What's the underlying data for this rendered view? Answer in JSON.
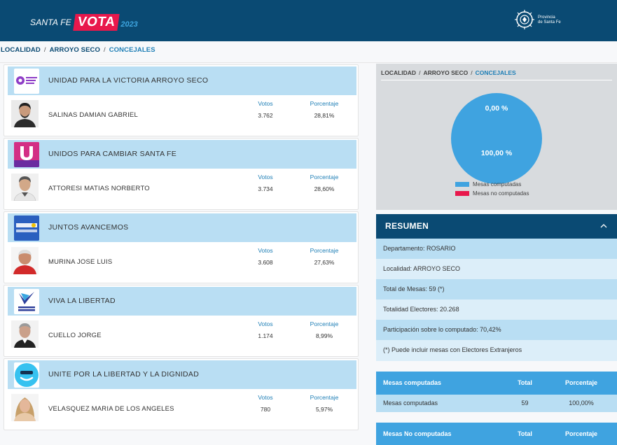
{
  "header": {
    "brand_santafe": "SANTA FE",
    "brand_vota": "VOTA",
    "brand_year": "2023",
    "province_line1": "Provincia",
    "province_line2": "de Santa Fe"
  },
  "breadcrumb": {
    "items": [
      "LOCALIDAD",
      "ARROYO SECO",
      "CONCEJALES"
    ],
    "separator": "/"
  },
  "results": {
    "votes_header": "Votos",
    "percent_header": "Porcentaje",
    "parties": [
      {
        "party": "UNIDAD PARA LA VICTORIA ARROYO SECO",
        "logo_text": "Unidad para la Victoria",
        "candidate": "SALINAS DAMIAN GABRIEL",
        "votes": "3.762",
        "percent": "28,81%"
      },
      {
        "party": "UNIDOS PARA CAMBIAR SANTA FE",
        "logo_text": "U",
        "candidate": "ATTORESI MATIAS NORBERTO",
        "votes": "3.734",
        "percent": "28,60%"
      },
      {
        "party": "JUNTOS AVANCEMOS",
        "logo_text": "JUNTOS AVANCEMOS",
        "candidate": "MURINA JOSE LUIS",
        "votes": "3.608",
        "percent": "27,63%"
      },
      {
        "party": "VIVA LA LIBERTAD",
        "logo_text": "VIVA LA LIBERTAD",
        "candidate": "CUELLO JORGE",
        "votes": "1.174",
        "percent": "8,99%"
      },
      {
        "party": "UNITE POR LA LIBERTAD Y LA DIGNIDAD",
        "logo_text": "Unite",
        "candidate": "VELASQUEZ MARIA DE LOS ANGELES",
        "votes": "780",
        "percent": "5,97%"
      }
    ]
  },
  "chart_panel": {
    "breadcrumb": [
      "LOCALIDAD",
      "ARROYO SECO",
      "CONCEJALES"
    ],
    "label_top": "0,00 %",
    "label_bottom": "100,00 %",
    "legend": [
      {
        "label": "Mesas computadas",
        "color": "#3fa3e0"
      },
      {
        "label": "Mesas no computadas",
        "color": "#e8184c"
      }
    ]
  },
  "chart_data": {
    "type": "pie",
    "categories": [
      "Mesas computadas",
      "Mesas no computadas"
    ],
    "values": [
      100.0,
      0.0
    ],
    "title": "",
    "legend_position": "bottom"
  },
  "resumen": {
    "title": "RESUMEN",
    "rows": [
      "Departamento: ROSARIO",
      "Localidad: ARROYO SECO",
      "Total de Mesas: 59 (*)",
      "Totalidad Electores: 20.268",
      "Participación sobre lo computado: 70,42%",
      "(*) Puede incluir mesas con Electores Extranjeros"
    ]
  },
  "mesas_computadas": {
    "header": {
      "label": "Mesas computadas",
      "total": "Total",
      "percent": "Porcentaje"
    },
    "row": {
      "label": "Mesas computadas",
      "total": "59",
      "percent": "100,00%"
    }
  },
  "mesas_no_computadas": {
    "header": {
      "label": "Mesas No computadas",
      "total": "Total",
      "percent": "Porcentaje"
    }
  },
  "colors": {
    "header_bg": "#0a4a73",
    "accent_blue": "#3fa3e0",
    "light_blue": "#b9def3",
    "vota_red": "#e8184c"
  }
}
